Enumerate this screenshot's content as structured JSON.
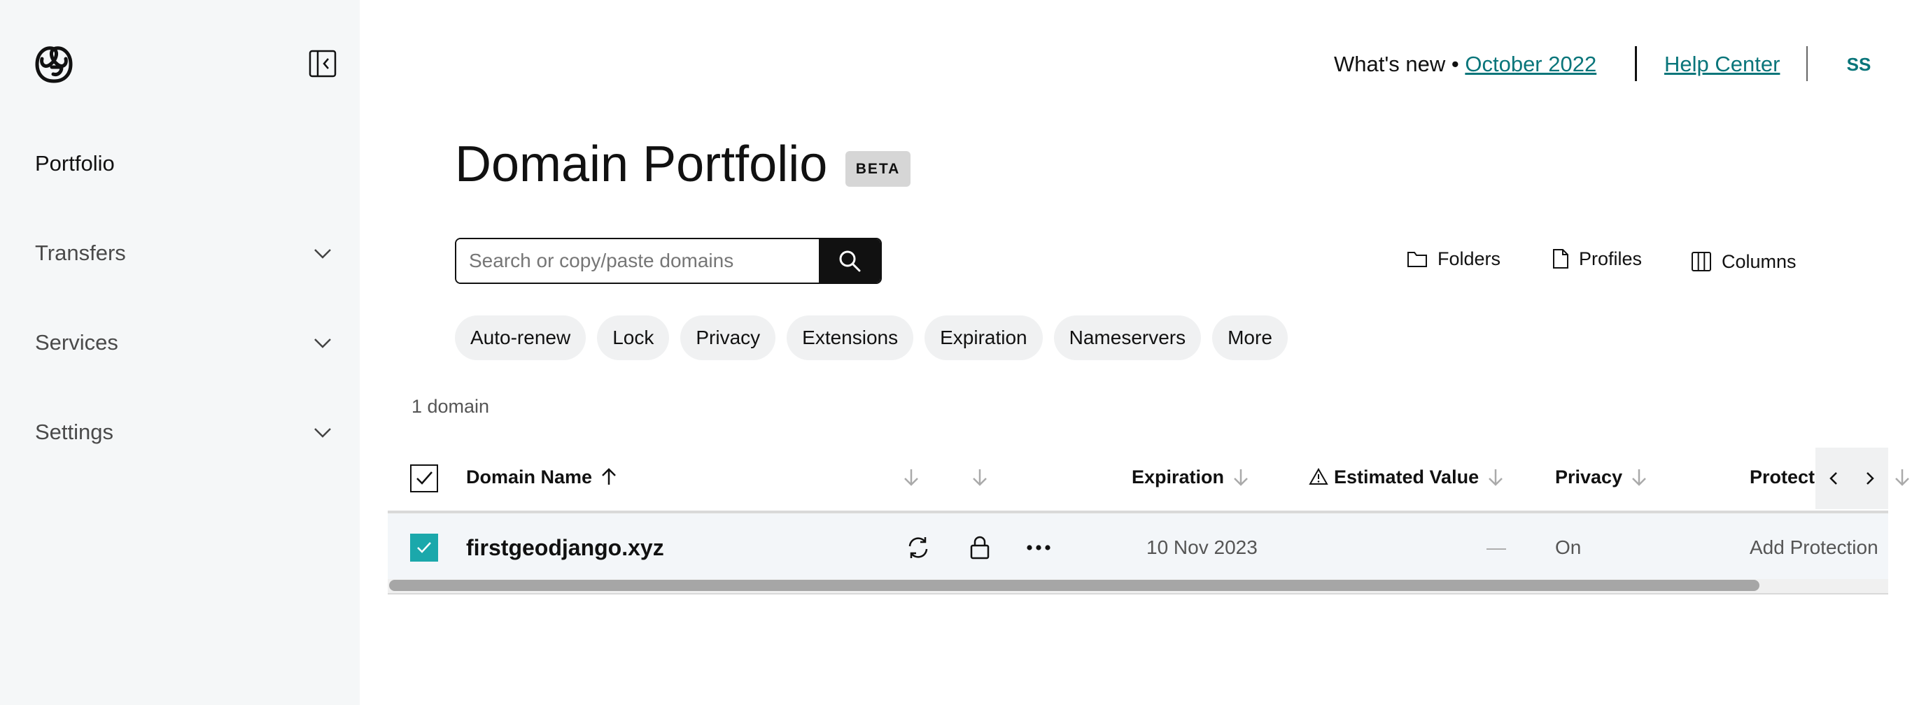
{
  "sidebar": {
    "items": [
      {
        "label": "Portfolio",
        "active": true,
        "expandable": false
      },
      {
        "label": "Transfers",
        "expandable": true
      },
      {
        "label": "Services",
        "expandable": true
      },
      {
        "label": "Settings",
        "expandable": true
      }
    ]
  },
  "header": {
    "whats_new_label": "What's new •",
    "whats_new_link": "October 2022",
    "help_center": "Help Center",
    "avatar_initials": "SS"
  },
  "page": {
    "title": "Domain Portfolio",
    "badge": "BETA"
  },
  "search": {
    "placeholder": "Search or copy/paste domains",
    "value": ""
  },
  "toolbar": {
    "folders": "Folders",
    "profiles": "Profiles",
    "columns": "Columns"
  },
  "filters": [
    "Auto-renew",
    "Lock",
    "Privacy",
    "Extensions",
    "Expiration",
    "Nameservers",
    "More"
  ],
  "count": "1 domain",
  "table": {
    "columns": {
      "domain_name": "Domain Name",
      "expiration": "Expiration",
      "estimated_value": "Estimated Value",
      "privacy": "Privacy",
      "protection": "Protect"
    },
    "rows": [
      {
        "domain": "firstgeodjango.xyz",
        "expiration": "10 Nov 2023",
        "estimated_value": "—",
        "privacy": "On",
        "protection": "Add Protection",
        "selected": true
      }
    ]
  },
  "colors": {
    "accent": "#09757a",
    "checkbox": "#1ba8ab",
    "sidebar_bg": "#f5f7f8",
    "row_bg": "#f3f6f9"
  },
  "icons": [
    "logo-icon",
    "collapse-sidebar-icon",
    "chevron-down-icon",
    "search-icon",
    "folder-icon",
    "file-icon",
    "columns-icon",
    "arrow-up-icon",
    "arrow-down-icon",
    "warning-icon",
    "refresh-icon",
    "lock-icon",
    "more-icon",
    "chevron-left-icon",
    "chevron-right-icon",
    "checkmark-icon"
  ]
}
